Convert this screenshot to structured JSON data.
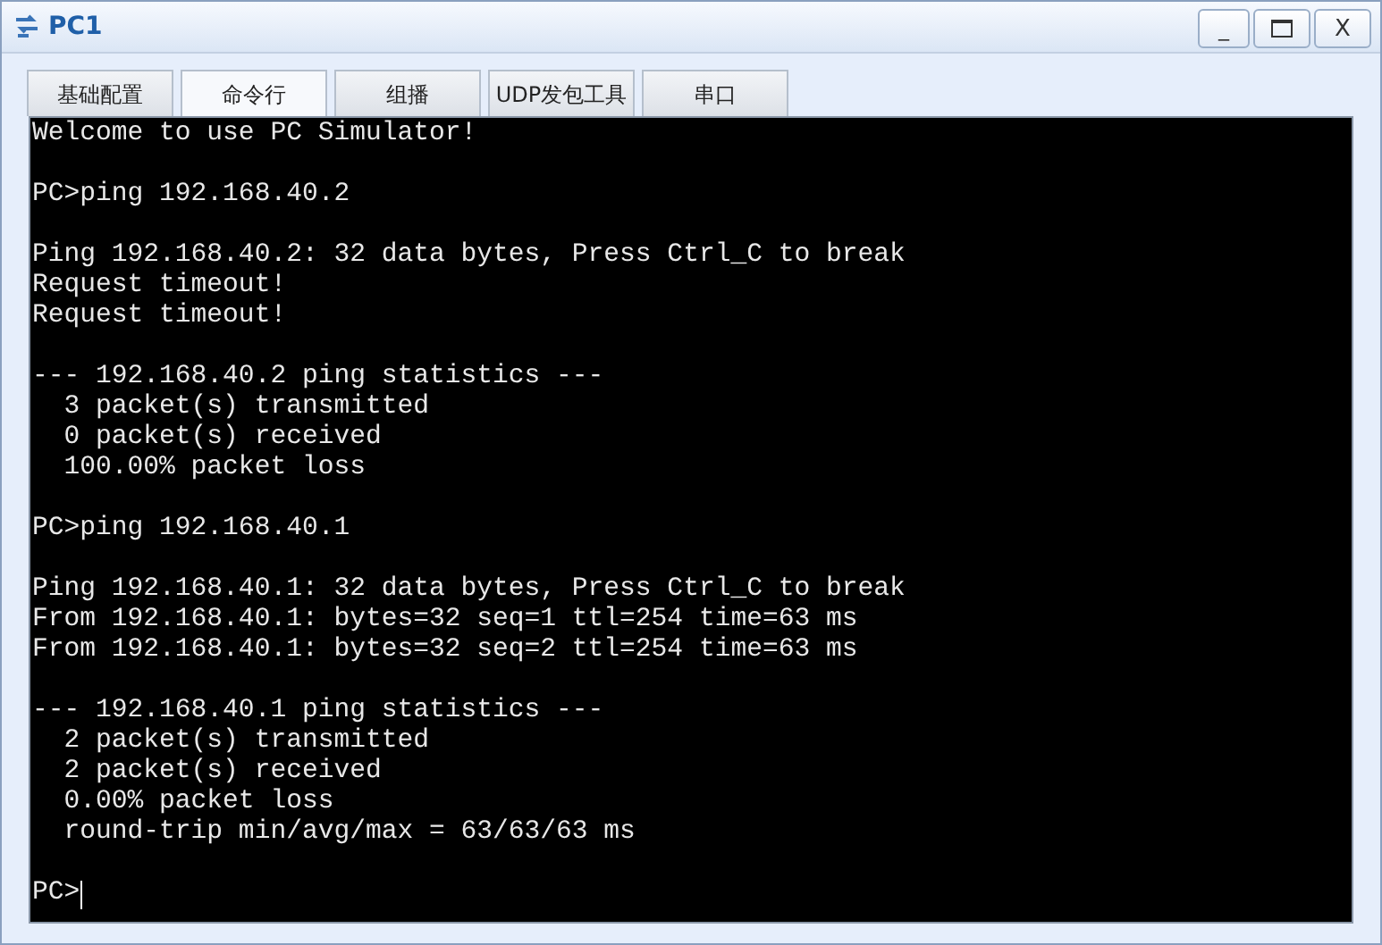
{
  "window": {
    "title": "PC1",
    "controls": [
      "_",
      "X"
    ]
  },
  "tabs": [
    {
      "label": "基础配置",
      "selected": false
    },
    {
      "label": "命令行",
      "selected": true
    },
    {
      "label": "组播",
      "selected": false
    },
    {
      "label": "UDP发包工具",
      "selected": false
    },
    {
      "label": "串口",
      "selected": false
    }
  ],
  "terminal": {
    "blocks": [
      [
        "Welcome to use PC Simulator!"
      ],
      [
        "PC>ping 192.168.40.2"
      ],
      [
        "Ping 192.168.40.2: 32 data bytes, Press Ctrl_C to break",
        "Request timeout!",
        "Request timeout!"
      ],
      [
        "--- 192.168.40.2 ping statistics ---",
        "  3 packet(s) transmitted",
        "  0 packet(s) received",
        "  100.00% packet loss"
      ],
      [
        "PC>ping 192.168.40.1"
      ],
      [
        "Ping 192.168.40.1: 32 data bytes, Press Ctrl_C to break",
        "From 192.168.40.1: bytes=32 seq=1 ttl=254 time=63 ms",
        "From 192.168.40.1: bytes=32 seq=2 ttl=254 time=63 ms"
      ],
      [
        "--- 192.168.40.1 ping statistics ---",
        "  2 packet(s) transmitted",
        "  2 packet(s) received",
        "  0.00% packet loss",
        "  round-trip min/avg/max = 63/63/63 ms"
      ]
    ],
    "prompt": "PC>"
  }
}
